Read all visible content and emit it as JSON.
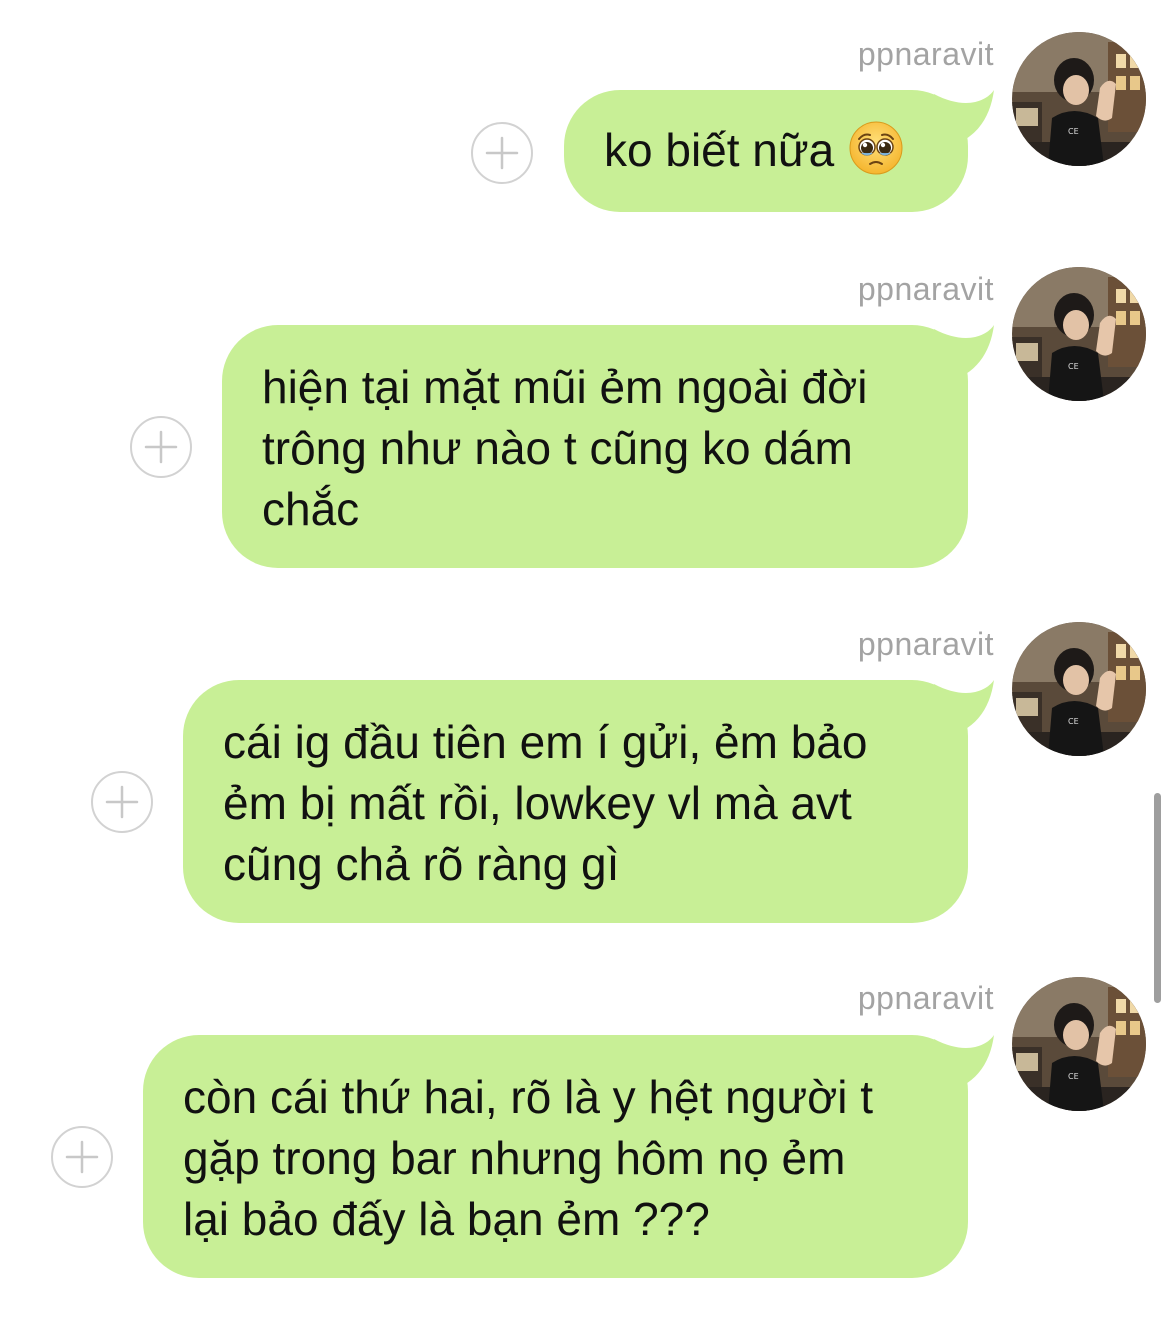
{
  "chat": {
    "messages": [
      {
        "sender": "ppnaravit",
        "text": "ko biết nữa",
        "emoji_icon": "pleading-face-emoji"
      },
      {
        "sender": "ppnaravit",
        "text": "hiện tại mặt mũi ẻm ngoài đời\ntrông như nào t cũng ko dám\nchắc"
      },
      {
        "sender": "ppnaravit",
        "text": "cái ig đầu tiên em í gửi, ẻm bảo\nẻm bị mất rồi, lowkey vl mà avt\ncũng chả rõ ràng gì"
      },
      {
        "sender": "ppnaravit",
        "text": "còn cái thứ hai, rõ là y hệt người t\ngặp trong bar nhưng hôm nọ ẻm\nlại bảo đấy là bạn ẻm ???"
      }
    ],
    "icons": {
      "add_button": "plus-circle-icon",
      "avatar": "avatar-photo"
    },
    "colors": {
      "bubble": "#c8ef96",
      "sender_name": "#a3a3a3",
      "text": "#111111",
      "add_button_border": "#d2d2d2"
    }
  }
}
